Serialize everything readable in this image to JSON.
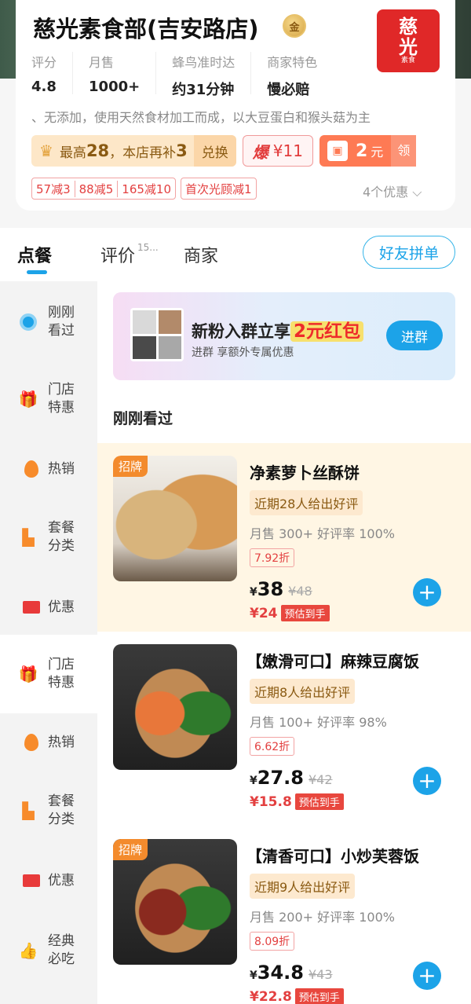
{
  "store": {
    "name": "慈光素食部(吉安路店)",
    "badge": "金",
    "logo_line1": "慈",
    "logo_line2": "光",
    "logo_small": "素食",
    "stats": [
      {
        "label": "评分",
        "value": "4.8"
      },
      {
        "label": "月售",
        "value": "1000+"
      },
      {
        "label": "蜂鸟准时达",
        "value": "约31分钟"
      },
      {
        "label": "商家特色",
        "value": "慢必赔"
      }
    ],
    "description": "、无添加，使用天然食材加工而成，以大豆蛋白和猴头菇为主",
    "promo_vip": {
      "prefix": "最高",
      "amount1": "28",
      "middle": "，本店再补",
      "amount2": "3",
      "button": "兑换"
    },
    "promo_burst": {
      "icon": "爆",
      "text": "¥11"
    },
    "promo_coupon": {
      "amount": "2",
      "unit": "元",
      "take": "领"
    },
    "discount_tags": [
      "57减3",
      "88减5",
      "165减10"
    ],
    "first_visit_tag": "首次光顾减1",
    "offers_link": "4个优惠 ⌵"
  },
  "tabs": [
    {
      "label": "点餐"
    },
    {
      "label": "评价",
      "count": "15..."
    },
    {
      "label": "商家"
    }
  ],
  "share_button": "好友拼单",
  "sidebar": [
    {
      "label": "刚刚看过",
      "icon": "eye-icon"
    },
    {
      "label": "门店特惠",
      "icon": "gift-icon"
    },
    {
      "label": "热销",
      "icon": "flame-icon"
    },
    {
      "label": "套餐分类",
      "icon": "combo-icon"
    },
    {
      "label": "优惠",
      "icon": "coupon-icon"
    },
    {
      "label": "门店特惠",
      "icon": "gift-icon"
    },
    {
      "label": "热销",
      "icon": "flame-icon"
    },
    {
      "label": "套餐分类",
      "icon": "combo-icon"
    },
    {
      "label": "优惠",
      "icon": "coupon-icon"
    },
    {
      "label": "经典必吃",
      "icon": "thumb-icon"
    }
  ],
  "banner": {
    "title_prefix": "新粉入群立享",
    "title_highlight": "2元红包",
    "subtitle": "进群 享额外专属优惠",
    "button": "进群"
  },
  "section_title": "刚刚看过",
  "dishes": [
    {
      "name": "净素萝卜丝酥饼",
      "sign": "招牌",
      "review": "近期28人给出好评",
      "sales": "月售 300+ 好评率 100%",
      "discount": "7.92折",
      "price": "38",
      "orig_price": "¥48",
      "est_price": "¥24",
      "est_label": "预估到手"
    },
    {
      "name": "【嫩滑可口】麻辣豆腐饭",
      "sign": "",
      "review": "近期8人给出好评",
      "sales": "月售 100+ 好评率 98%",
      "discount": "6.62折",
      "price": "27.8",
      "orig_price": "¥42",
      "est_price": "¥15.8",
      "est_label": "预估到手"
    },
    {
      "name": "【清香可口】小炒芙蓉饭",
      "sign": "招牌",
      "review": "近期9人给出好评",
      "sales": "月售 200+ 好评率 100%",
      "discount": "8.09折",
      "price": "34.8",
      "orig_price": "¥43",
      "est_price": "¥22.8",
      "est_label": "预估到手"
    }
  ],
  "currency": "¥",
  "add_symbol": "+"
}
